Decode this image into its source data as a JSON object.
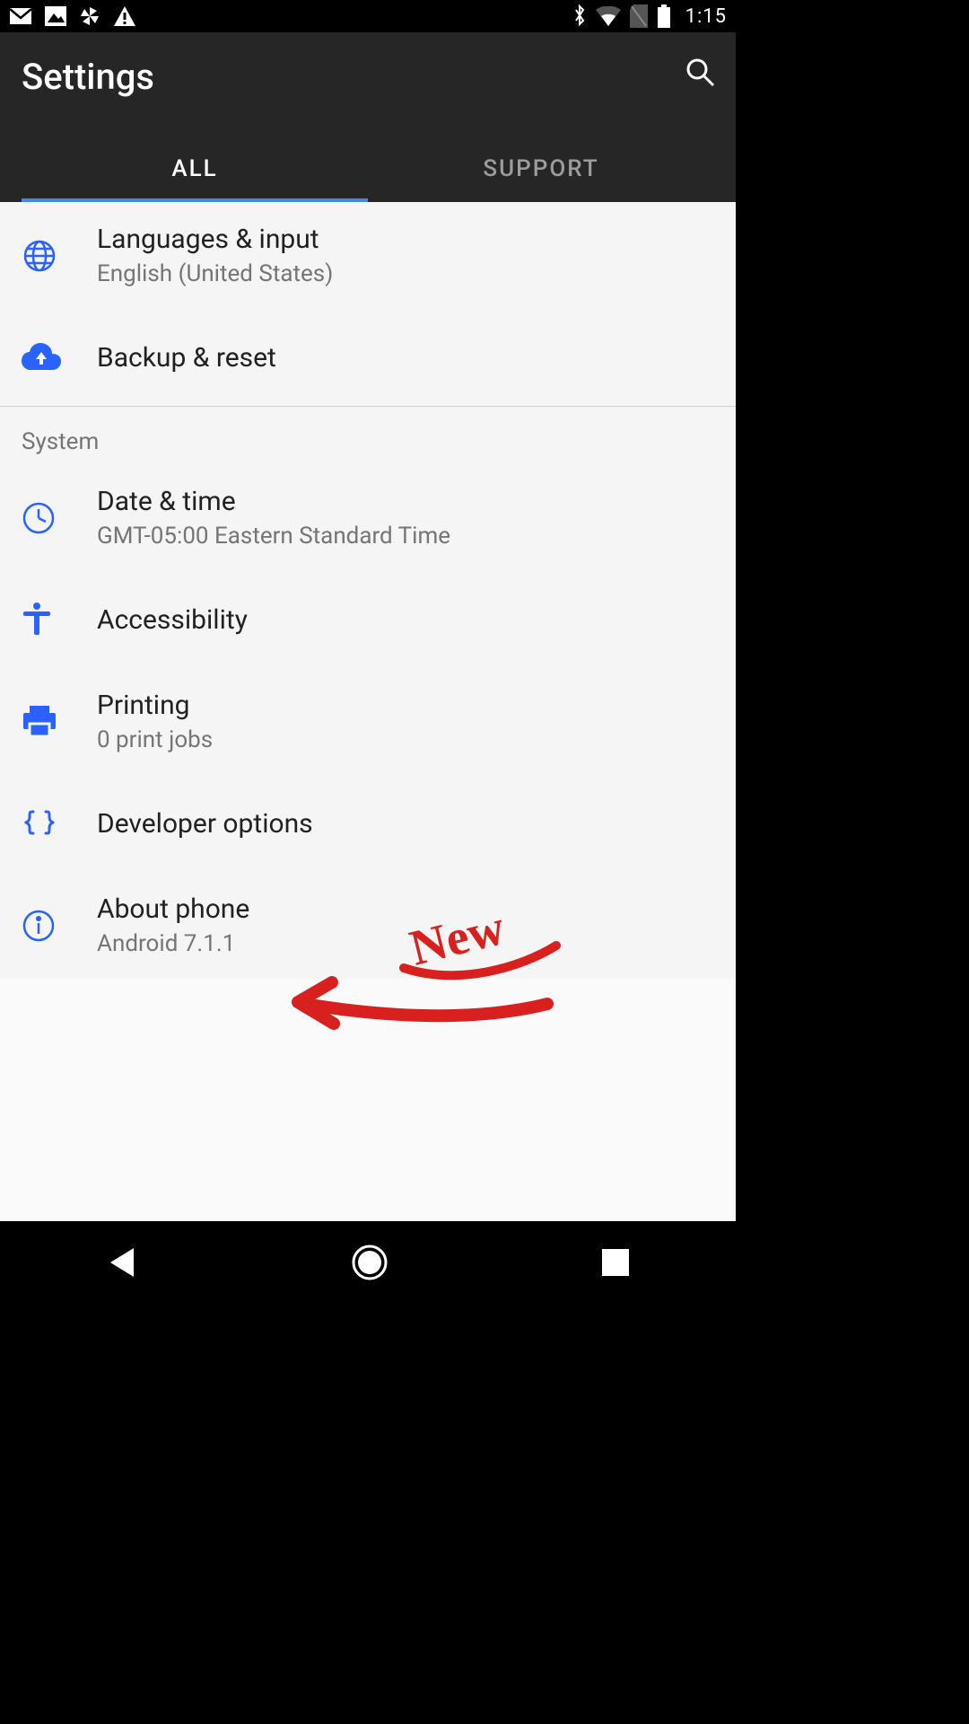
{
  "status": {
    "time": "1:15"
  },
  "toolbar": {
    "title": "Settings"
  },
  "tabs": {
    "all": "ALL",
    "support": "SUPPORT"
  },
  "items": {
    "languages": {
      "label": "Languages & input",
      "sub": "English (United States)"
    },
    "backup": {
      "label": "Backup & reset"
    },
    "datetime": {
      "label": "Date & time",
      "sub": "GMT-05:00 Eastern Standard Time"
    },
    "accessibility": {
      "label": "Accessibility"
    },
    "printing": {
      "label": "Printing",
      "sub": "0 print jobs"
    },
    "developer": {
      "label": "Developer options"
    },
    "about": {
      "label": "About phone",
      "sub": "Android 7.1.1"
    }
  },
  "section": {
    "system": "System"
  },
  "annotation": {
    "text": "New"
  },
  "colors": {
    "accent": "#2962ff"
  }
}
